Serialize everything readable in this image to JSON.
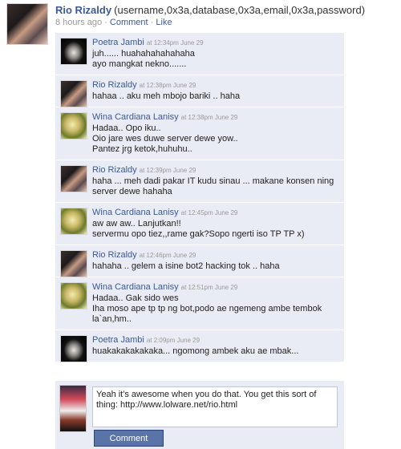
{
  "post": {
    "author": "Rio Rizaldy",
    "message": "(username,0x3a,database,0x3a,email,0x3a,password)",
    "time": "8 hours ago",
    "separator": "·",
    "comment_link": "Comment",
    "like_link": "Like"
  },
  "comments": [
    {
      "author": "Poetra Jambi",
      "time": "at 12:34pm June 29",
      "text": "juh...... huahahahahahaha\nayo mangkat nekno.......",
      "avatar": "poetra"
    },
    {
      "author": "Rio Rizaldy",
      "time": "at 12:38pm June 29",
      "text": "hahaa .. aku meh mbojo bariki .. haha",
      "avatar": "rio"
    },
    {
      "author": "Wina Cardiana Lanisy",
      "time": "at 12:38pm June 29",
      "text": "Hadaa.. Opo iku..\nOio jare wes duwe server dewe yow..\nPantez jrg ketok,huhuhu..",
      "avatar": "wina"
    },
    {
      "author": "Rio Rizaldy",
      "time": "at 12:39pm June 29",
      "text": "haha ... meh dadi pakar IT kudu sinau ... makane konsen ning server dewe hahaha",
      "avatar": "rio"
    },
    {
      "author": "Wina Cardiana Lanisy",
      "time": "at 12:45pm June 29",
      "text": "aw aw aw.. Lanjutkan!!\nservermu opo tiez,,rame gak?Sopo ngerti iso TP TP x)",
      "avatar": "wina"
    },
    {
      "author": "Rio Rizaldy",
      "time": "at 12:46pm June 29",
      "text": "hahaha .. gelem a isine bot2 hacking tok .. haha",
      "avatar": "rio"
    },
    {
      "author": "Wina Cardiana Lanisy",
      "time": "at 12:51pm June 29",
      "text": "Hadaa.. Gak sido wes\nIha moso ape tp tp ng bot,podo ae ngemeng ambe tembok la`an,hm..",
      "avatar": "wina"
    },
    {
      "author": "Poetra Jambi",
      "time": "at 2:09pm June 29",
      "text": "huakakakakakaka... ngomong ambek aku ae mbak...",
      "avatar": "poetra"
    }
  ],
  "composer": {
    "value": "Yeah it's awesome when you do that. You get this sort of thing: http://www.lolware.net/rio.html",
    "button_label": "Comment"
  }
}
